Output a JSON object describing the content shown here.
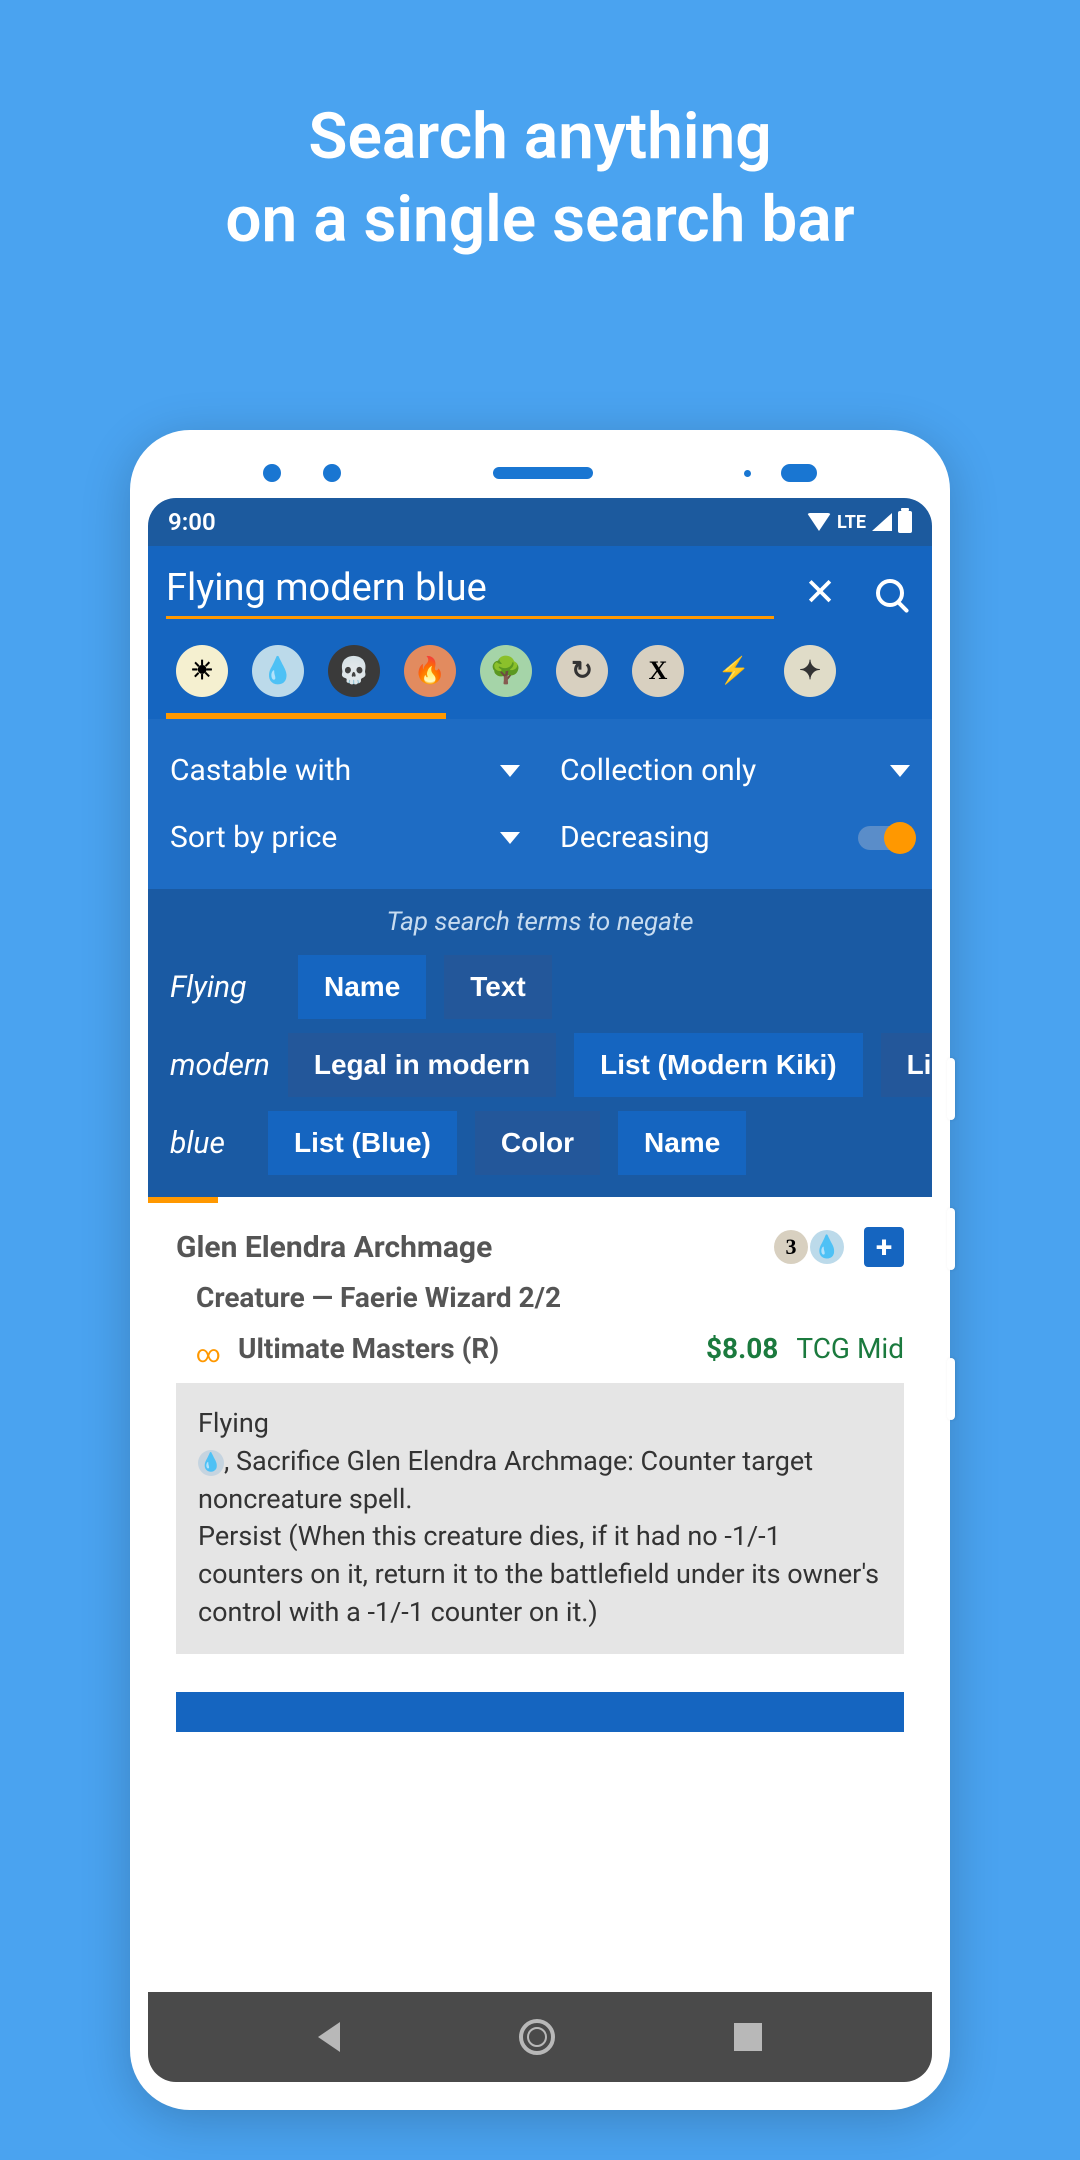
{
  "promo": {
    "line1": "Search anything",
    "line2": "on a single search bar"
  },
  "status": {
    "time": "9:00",
    "network": "LTE"
  },
  "search": {
    "value": "Flying modern blue"
  },
  "mana_icons": [
    "white",
    "blue",
    "black",
    "red",
    "green",
    "tap",
    "x",
    "bolt",
    "spark"
  ],
  "filters": {
    "castable": "Castable with",
    "collection": "Collection only",
    "sort": "Sort by price",
    "direction": "Decreasing"
  },
  "terms": {
    "hint": "Tap search terms to negate",
    "rows": [
      {
        "label": "Flying",
        "chips": [
          "Name",
          "Text"
        ]
      },
      {
        "label": "modern",
        "chips": [
          "Legal in modern",
          "List (Modern Kiki)",
          "Li"
        ]
      },
      {
        "label": "blue",
        "chips": [
          "List (Blue)",
          "Color",
          "Name"
        ]
      }
    ]
  },
  "card": {
    "name": "Glen Elendra Archmage",
    "cost_generic": "3",
    "type": "Creature — Faerie Wizard 2/2",
    "set": "Ultimate Masters (R)",
    "price": "$8.08",
    "price_source": "TCG Mid",
    "text_flying": "Flying",
    "text_ability": ", Sacrifice Glen Elendra Archmage: Counter target noncreature spell.",
    "text_persist": "Persist (When this creature dies, if it had no -1/-1 counters on it, return it to the battlefield under its owner's control with a -1/-1 counter on it.)"
  }
}
